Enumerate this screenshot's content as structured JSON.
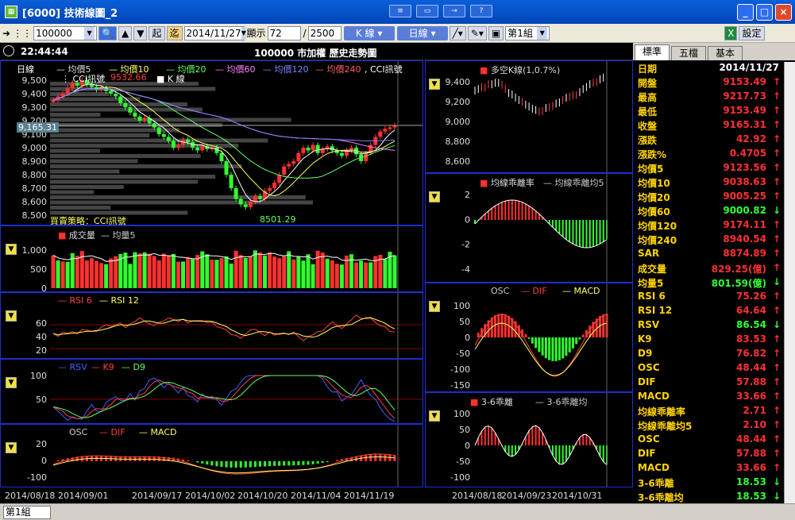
{
  "window": {
    "title": "[6000] 技術線圖_2",
    "controls": [
      "_",
      "□",
      "×"
    ]
  },
  "mini_toolbar": [
    "≡",
    "▭",
    "→",
    "?"
  ],
  "toolbar": {
    "code": "100000",
    "date": "2014/11/27",
    "show_label": "顯示",
    "show_count": "72",
    "sep": "/",
    "total": "2500",
    "kline_label": "K 線",
    "period_label": "日線",
    "group_label": "第1組",
    "settings_label": "設定",
    "btn_start": "起",
    "btn_end": "迄"
  },
  "header": {
    "time": "22:44:44",
    "title": "100000 市加權  歷史走勢圖"
  },
  "main_panel": {
    "legend": [
      "日線",
      "均價5",
      "均價10",
      "均價20",
      "均價60",
      "均價120",
      "均價240",
      "CCI訊號"
    ],
    "legend2": [
      "CCI訊號",
      "K 線"
    ],
    "high_label": "9532.66",
    "low_label": "8501.29",
    "price_tag": "9,165.31",
    "strategy": "買賣策略：CCI訊號",
    "yticks": [
      "9,500",
      "9,400",
      "9,300",
      "9,200",
      "9,100",
      "9,000",
      "8,900",
      "8,800",
      "8,700",
      "8,600",
      "8,500"
    ]
  },
  "vol_panel": {
    "legend": [
      "成交量",
      "均量5"
    ],
    "yticks": [
      "1,000",
      "500",
      "0"
    ]
  },
  "rsi_panel": {
    "legend": [
      "RSI 6",
      "RSI 12"
    ],
    "yticks": [
      "60",
      "40",
      "20"
    ]
  },
  "kd_panel": {
    "legend": [
      "RSV",
      "K9",
      "D9"
    ],
    "yticks": [
      "100",
      "50"
    ]
  },
  "macd_panel": {
    "legend": [
      "OSC",
      "DIF",
      "MACD"
    ],
    "yticks": [
      "20",
      "0",
      "-100"
    ]
  },
  "r1": {
    "legend": "多空K線(1,0.7%)",
    "yticks": [
      "9,400",
      "9,200",
      "9,000",
      "8,800",
      "8,600"
    ]
  },
  "r2": {
    "legend": [
      "均線乖離率",
      "均線乖離均5"
    ],
    "yticks": [
      "2",
      "0",
      "-2",
      "-4"
    ]
  },
  "r3": {
    "legend": [
      "OSC",
      "DIF",
      "MACD"
    ],
    "yticks": [
      "100",
      "50",
      "0",
      "-50",
      "-100",
      "-150"
    ]
  },
  "r4": {
    "legend": [
      "3-6乖離",
      "3-6乖離均"
    ],
    "yticks": [
      "100",
      "50",
      "0",
      "-50",
      "-100"
    ]
  },
  "xaxis": [
    "2014/08/18",
    "2014/09/01",
    "2014/09/17",
    "2014/10/02",
    "2014/10/20",
    "2014/11/04",
    "2014/11/19"
  ],
  "xaxis_r": [
    "2014/08/18",
    "2014/09/23",
    "2014/10/31"
  ],
  "tabs": [
    "標準",
    "五檔",
    "基本"
  ],
  "quote": [
    {
      "k": "日期",
      "v": "2014/11/27",
      "c": "y",
      "a": ""
    },
    {
      "k": "開盤",
      "v": "9153.49",
      "c": "up",
      "a": "↑"
    },
    {
      "k": "最高",
      "v": "9217.73",
      "c": "up",
      "a": "↑"
    },
    {
      "k": "最低",
      "v": "9153.49",
      "c": "up",
      "a": "↑"
    },
    {
      "k": "收盤",
      "v": "9165.31",
      "c": "up",
      "a": "↑"
    },
    {
      "k": "漲跌",
      "v": "42.92",
      "c": "up",
      "a": "↑"
    },
    {
      "k": "漲跌%",
      "v": "0.4705",
      "c": "up",
      "a": "↑"
    },
    {
      "k": "均價5",
      "v": "9123.56",
      "c": "up",
      "a": "↑"
    },
    {
      "k": "均價10",
      "v": "9038.63",
      "c": "up",
      "a": "↑"
    },
    {
      "k": "均價20",
      "v": "9005.25",
      "c": "up",
      "a": "↑"
    },
    {
      "k": "均價60",
      "v": "9000.82",
      "c": "dn",
      "a": "↓"
    },
    {
      "k": "均價120",
      "v": "9174.11",
      "c": "up",
      "a": "↑"
    },
    {
      "k": "均價240",
      "v": "8940.54",
      "c": "up",
      "a": "↑"
    },
    {
      "k": "SAR",
      "v": "8874.89",
      "c": "up",
      "a": "↑"
    },
    {
      "k": "成交量",
      "v": "829.25(億)",
      "c": "up",
      "a": "↑"
    },
    {
      "k": "均量5",
      "v": "801.59(億)",
      "c": "dn",
      "a": "↓"
    },
    {
      "k": "RSI 6",
      "v": "75.26",
      "c": "up",
      "a": "↑"
    },
    {
      "k": "RSI 12",
      "v": "64.64",
      "c": "up",
      "a": "↑"
    },
    {
      "k": "RSV",
      "v": "86.54",
      "c": "dn",
      "a": "↓"
    },
    {
      "k": "K9",
      "v": "83.53",
      "c": "up",
      "a": "↑"
    },
    {
      "k": "D9",
      "v": "76.82",
      "c": "up",
      "a": "↑"
    },
    {
      "k": "OSC",
      "v": "48.44",
      "c": "up",
      "a": "↑"
    },
    {
      "k": "DIF",
      "v": "57.88",
      "c": "up",
      "a": "↑"
    },
    {
      "k": "MACD",
      "v": "33.66",
      "c": "up",
      "a": "↑"
    },
    {
      "k": "均線乖離率",
      "v": "2.71",
      "c": "up",
      "a": "↑"
    },
    {
      "k": "均線乖離均5",
      "v": "2.10",
      "c": "up",
      "a": "↑"
    },
    {
      "k": "OSC",
      "v": "48.44",
      "c": "up",
      "a": "↑"
    },
    {
      "k": "DIF",
      "v": "57.88",
      "c": "up",
      "a": "↑"
    },
    {
      "k": "MACD",
      "v": "33.66",
      "c": "up",
      "a": "↑"
    },
    {
      "k": "3-6乖離",
      "v": "18.53",
      "c": "dn",
      "a": "↓"
    },
    {
      "k": "3-6乖離均",
      "v": "18.53",
      "c": "dn",
      "a": "↓"
    }
  ],
  "status": {
    "group": "第1組"
  },
  "colors": {
    "up": "#ff3030",
    "down": "#30ff30",
    "border": "#1a2fd0"
  }
}
